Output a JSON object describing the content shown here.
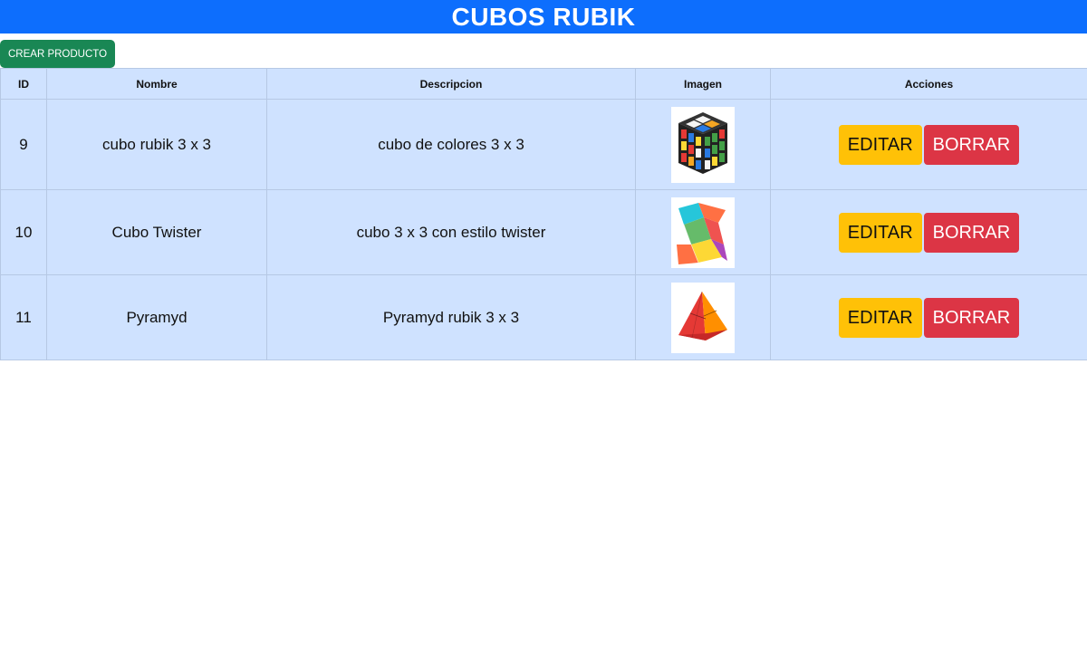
{
  "header": {
    "title": "CUBOS RUBIK"
  },
  "toolbar": {
    "create_label": "CREAR PRODUCTO"
  },
  "table": {
    "headers": [
      "ID",
      "Nombre",
      "Descripcion",
      "Imagen",
      "Acciones"
    ],
    "rows": [
      {
        "id": "9",
        "nombre": "cubo rubik 3 x 3",
        "descripcion": "cubo de colores 3 x 3",
        "imagen": "rubiks-cube-image",
        "edit_label": "EDITAR",
        "delete_label": "BORRAR"
      },
      {
        "id": "10",
        "nombre": "Cubo Twister",
        "descripcion": "cubo 3 x 3 con estilo twister",
        "imagen": "twister-cube-image",
        "edit_label": "EDITAR",
        "delete_label": "BORRAR"
      },
      {
        "id": "11",
        "nombre": "Pyramyd",
        "descripcion": "Pyramyd rubik 3 x 3",
        "imagen": "pyramid-cube-image",
        "edit_label": "EDITAR",
        "delete_label": "BORRAR"
      }
    ]
  },
  "colors": {
    "header": "#0d6efd",
    "create_button": "#198754",
    "table_bg": "#cfe2ff",
    "edit_button": "#ffc107",
    "delete_button": "#dc3545"
  }
}
